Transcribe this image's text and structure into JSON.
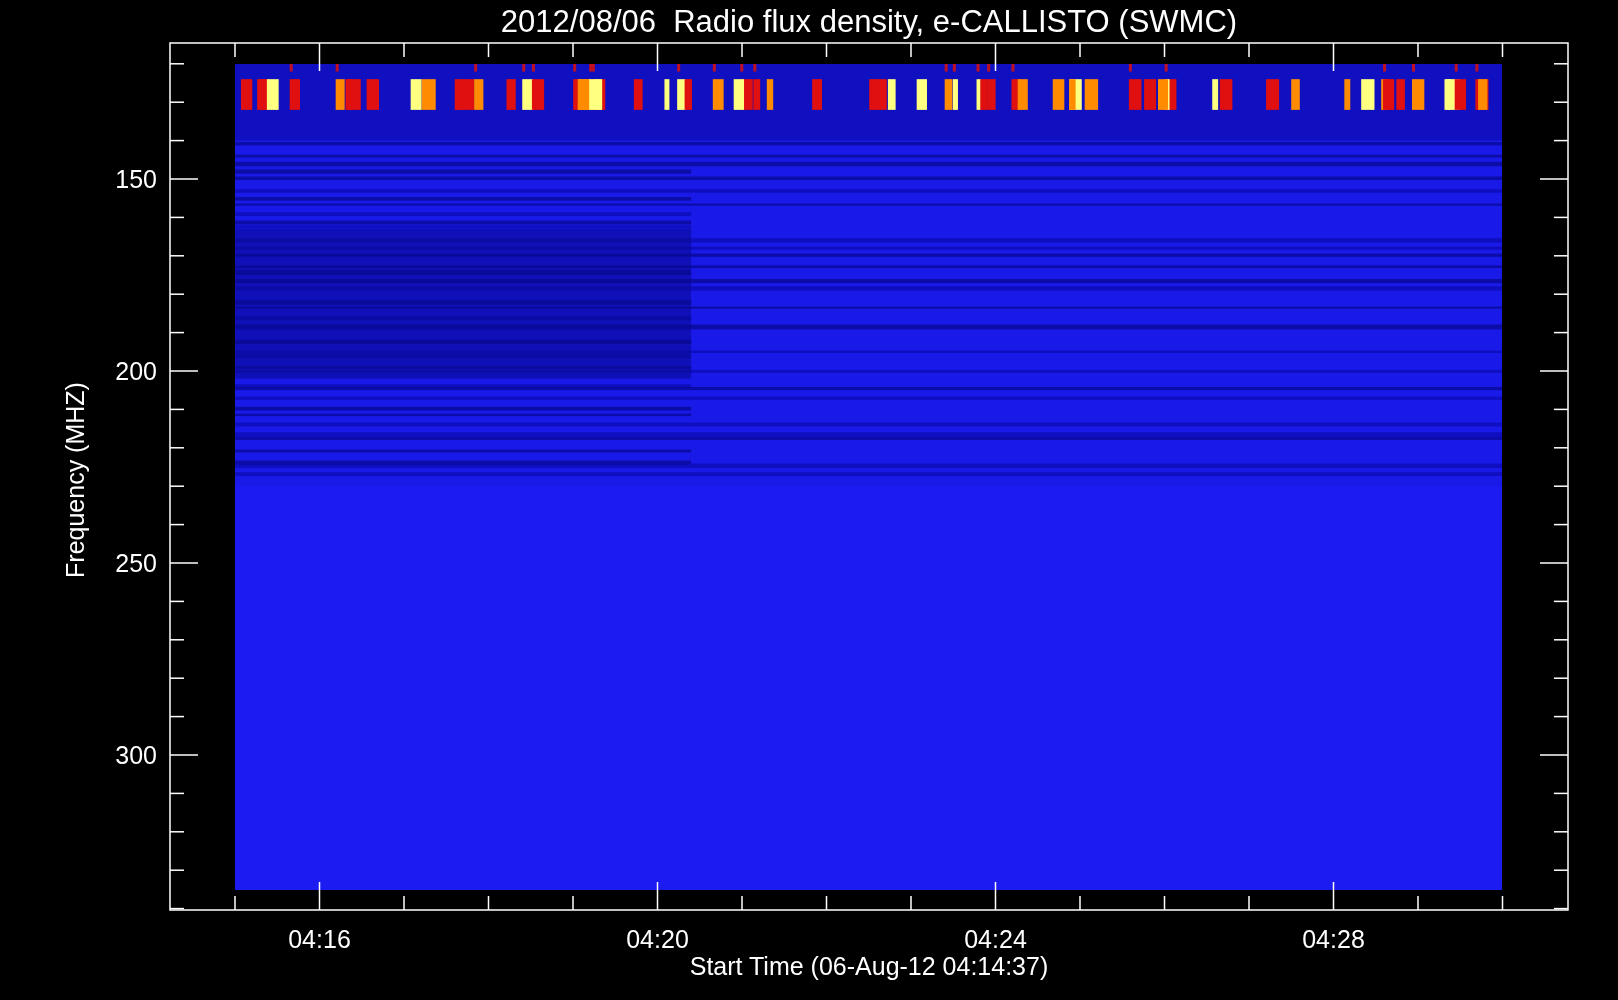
{
  "title": "2012/08/06  Radio flux density, e-CALLISTO (SWMC)",
  "y_axis": {
    "label": "Frequency (MHZ)",
    "ticks": [
      "150",
      "200",
      "250",
      "300"
    ]
  },
  "x_axis": {
    "label": "Start Time (06-Aug-12 04:14:37)",
    "ticks": [
      "04:16",
      "04:20",
      "04:24",
      "04:28"
    ]
  }
}
